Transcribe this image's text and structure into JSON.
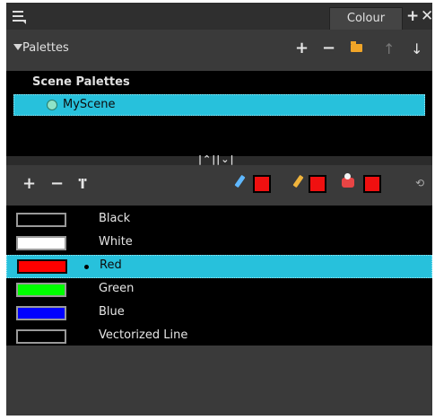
{
  "titlebar": {
    "tab_label": "Colour",
    "add_icon": "plus-icon",
    "close_icon": "close-icon",
    "menu_icon": "hamburger-menu-icon"
  },
  "palettes": {
    "label": "Palettes",
    "expanded": true
  },
  "scene_palettes": {
    "title": "Scene Palettes",
    "items": [
      {
        "name": "MyScene",
        "selected": true
      }
    ]
  },
  "swatches": [
    {
      "name": "Black",
      "color": "#000000",
      "selected": false
    },
    {
      "name": "White",
      "color": "#ffffff",
      "selected": false
    },
    {
      "name": "Red",
      "color": "#ff0000",
      "selected": true
    },
    {
      "name": "Green",
      "color": "#00ff00",
      "selected": false
    },
    {
      "name": "Blue",
      "color": "#0000ff",
      "selected": false
    },
    {
      "name": "Vectorized Line",
      "color": "#000000",
      "selected": false
    }
  ],
  "current_colors": {
    "brush": "#f01010",
    "pencil": "#f01010",
    "paint": "#f01010"
  },
  "colors": {
    "selection": "#27c1dc",
    "panel": "#3a3a3a"
  }
}
